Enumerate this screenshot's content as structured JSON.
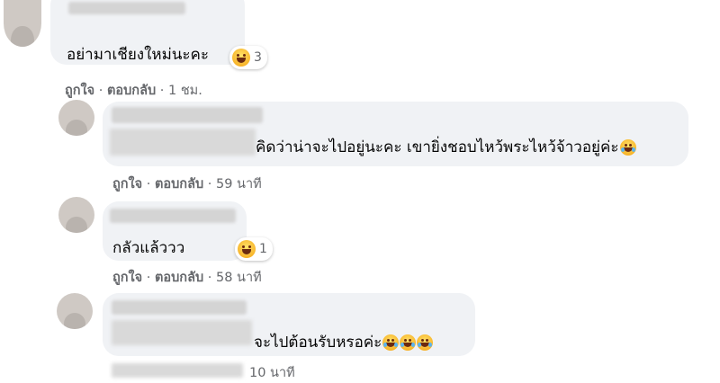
{
  "comments": [
    {
      "text": "อย่ามาเชียงใหม่นะคะ",
      "reaction_count": "3",
      "like_label": "ถูกใจ",
      "reply_label": "ตอบกลับ",
      "time": "1 ชม."
    },
    {
      "text": "คิดว่าน่าจะไปอยู่นะคะ เขายิ่งชอบไหว้พระไหว้จ้าวอยู่ค่ะ",
      "like_label": "ถูกใจ",
      "reply_label": "ตอบกลับ",
      "time": "59 นาที"
    },
    {
      "text": "กลัวแล้ววว",
      "reaction_count": "1",
      "like_label": "ถูกใจ",
      "reply_label": "ตอบกลับ",
      "time": "58 นาที"
    },
    {
      "text": "จะไปต้อนรับหรอค่ะ",
      "time": "10 นาที"
    }
  ],
  "separator": "·",
  "icons": {
    "reaction": "haha-emoji-icon",
    "inline_emoji": "face-with-tears-of-joy-icon"
  }
}
